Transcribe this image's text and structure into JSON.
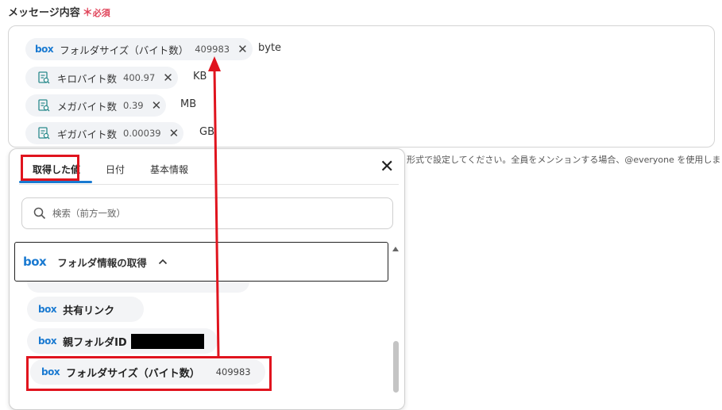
{
  "field": {
    "label": "メッセージ内容",
    "required_star": "＊",
    "required_text": "必須"
  },
  "message": {
    "chips": [
      {
        "icon": "box-logo-icon",
        "label": "フォルダサイズ（バイト数）",
        "value": "409983",
        "suffix": "byte"
      },
      {
        "icon": "document-search-icon",
        "label": "キロバイト数",
        "value": "400.97",
        "suffix": "KB"
      },
      {
        "icon": "document-search-icon",
        "label": "メガバイト数",
        "value": "0.39",
        "suffix": "MB"
      },
      {
        "icon": "document-search-icon",
        "label": "ギガバイト数",
        "value": "0.00039",
        "suffix": "GB"
      }
    ],
    "hint": "形式で設定してください。全員をメンションする場合、@everyone を使用しま"
  },
  "panel": {
    "tabs": [
      "取得した値",
      "日付",
      "基本情報"
    ],
    "active_tab": "取得した値",
    "search_placeholder": "検索（前方一致）",
    "section_title": "フォルダ情報の取得",
    "brand_text": "box",
    "items": [
      {
        "label": "共有リンク",
        "value": ""
      },
      {
        "label": "親フォルダID",
        "value": ""
      },
      {
        "label": "フォルダサイズ（バイト数）",
        "value": "409983"
      }
    ]
  },
  "colors": {
    "accent": "#1a7ad1",
    "required": "#e0445a",
    "highlight": "#e0141e"
  }
}
